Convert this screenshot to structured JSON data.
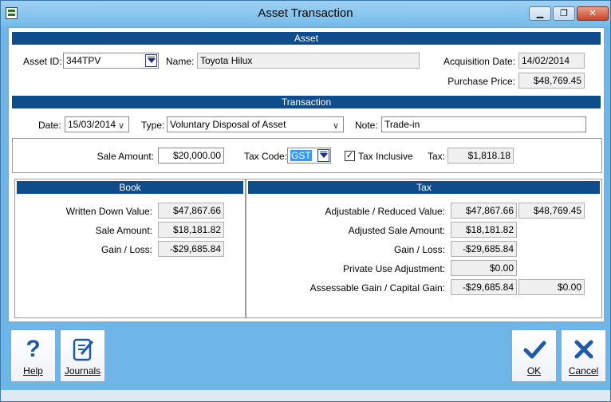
{
  "window": {
    "title": "Asset Transaction",
    "min_label": "▁",
    "max_label": "❐",
    "close_label": "✕"
  },
  "asset": {
    "header": "Asset",
    "asset_id_label": "Asset ID:",
    "asset_id_value": "344TPV",
    "name_label": "Name:",
    "name_value": "Toyota Hilux",
    "acq_date_label": "Acquisition Date:",
    "acq_date_value": "14/02/2014",
    "purchase_price_label": "Purchase Price:",
    "purchase_price_value": "$48,769.45"
  },
  "transaction": {
    "header": "Transaction",
    "date_label": "Date:",
    "date_value": "15/03/2014",
    "type_label": "Type:",
    "type_value": "Voluntary Disposal of Asset",
    "note_label": "Note:",
    "note_value": "Trade-in",
    "sale_amount_label": "Sale Amount:",
    "sale_amount_value": "$20,000.00",
    "tax_code_label": "Tax Code:",
    "tax_code_value": "GST",
    "tax_inclusive_label": "Tax Inclusive",
    "tax_inclusive_checked": true,
    "tax_label": "Tax:",
    "tax_value": "$1,818.18"
  },
  "book": {
    "header": "Book",
    "wdv_label": "Written Down Value:",
    "wdv_value": "$47,867.66",
    "sale_amount_label": "Sale Amount:",
    "sale_amount_value": "$18,181.82",
    "gain_loss_label": "Gain / Loss:",
    "gain_loss_value": "-$29,685.84"
  },
  "tax": {
    "header": "Tax",
    "adj_reduced_label": "Adjustable / Reduced Value:",
    "adj_reduced_value": "$47,867.66",
    "adj_reduced_value2": "$48,769.45",
    "adj_sale_label": "Adjusted Sale Amount:",
    "adj_sale_value": "$18,181.82",
    "gain_loss_label": "Gain / Loss:",
    "gain_loss_value": "-$29,685.84",
    "private_use_label": "Private Use Adjustment:",
    "private_use_value": "$0.00",
    "assessable_label": "Assessable Gain / Capital Gain:",
    "assessable_value": "-$29,685.84",
    "assessable_value2": "$0.00"
  },
  "toolbar": {
    "help_label": "Help",
    "journals_label": "Journals",
    "ok_label": "OK",
    "cancel_label": "Cancel"
  },
  "icons": {
    "help": "question-mark-icon",
    "journals": "journal-pencil-icon",
    "ok": "checkmark-icon",
    "cancel": "x-icon"
  },
  "colors": {
    "section_header": "#0f4c8c",
    "frame": "#6eb6e8",
    "icon_blue": "#1e5aa8"
  }
}
